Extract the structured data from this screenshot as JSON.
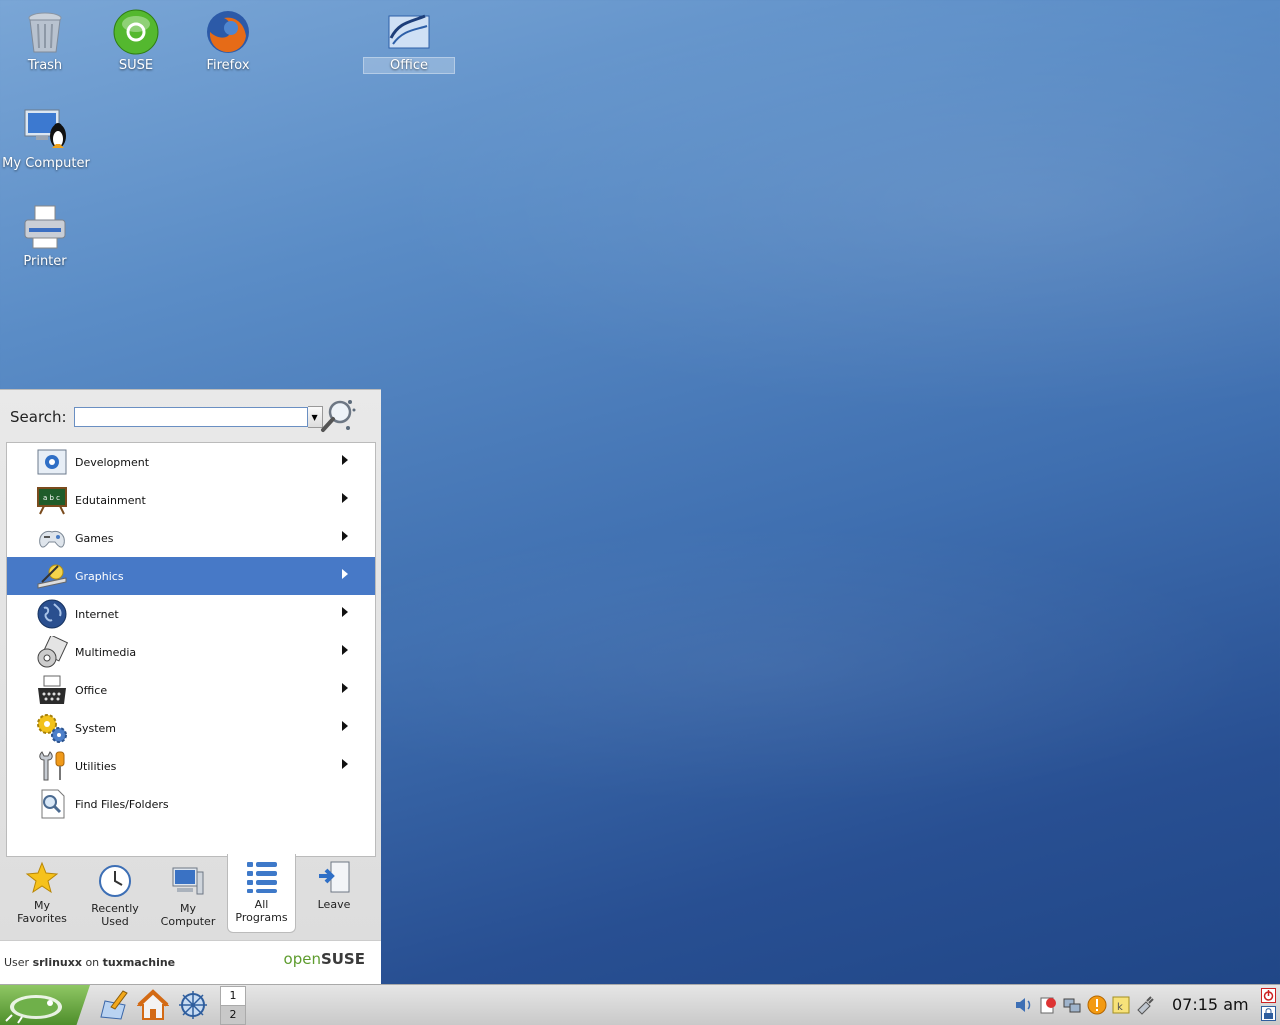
{
  "desktop": {
    "icons": [
      {
        "id": "trash",
        "label": "Trash",
        "icon": "trash-icon"
      },
      {
        "id": "suse",
        "label": "SUSE",
        "icon": "suse-icon"
      },
      {
        "id": "firefox",
        "label": "Firefox",
        "icon": "firefox-icon"
      },
      {
        "id": "office",
        "label": "Office",
        "icon": "office-icon"
      },
      {
        "id": "mycomputer",
        "label": "My Computer",
        "icon": "computer-icon"
      },
      {
        "id": "printer",
        "label": "Printer",
        "icon": "printer-icon"
      }
    ]
  },
  "menu": {
    "search_label": "Search:",
    "search_value": "",
    "items": [
      {
        "label": "Development",
        "icon": "development-icon",
        "submenu": true
      },
      {
        "label": "Edutainment",
        "icon": "edutainment-icon",
        "submenu": true
      },
      {
        "label": "Games",
        "icon": "gamepad-icon",
        "submenu": true
      },
      {
        "label": "Graphics",
        "icon": "graphics-icon",
        "submenu": true,
        "selected": true
      },
      {
        "label": "Internet",
        "icon": "globe-icon",
        "submenu": true
      },
      {
        "label": "Multimedia",
        "icon": "multimedia-icon",
        "submenu": true
      },
      {
        "label": "Office",
        "icon": "typewriter-icon",
        "submenu": true
      },
      {
        "label": "System",
        "icon": "gears-icon",
        "submenu": true
      },
      {
        "label": "Utilities",
        "icon": "tools-icon",
        "submenu": true
      },
      {
        "label": "Find Files/Folders",
        "icon": "find-files-icon",
        "submenu": false
      }
    ],
    "tabs": [
      {
        "line1": "My",
        "line2": "Favorites",
        "ul1": "",
        "ul2": "F",
        "rest2": "avorites",
        "icon": "star-icon"
      },
      {
        "line1": "Recently",
        "line2": "Used",
        "icon": "clock-icon"
      },
      {
        "line1": "My",
        "line2": "Computer",
        "icon": "computer-icon"
      },
      {
        "line1": "All",
        "line2": "Programs",
        "icon": "list-icon",
        "active": true
      },
      {
        "line1": "Leave",
        "line2": "",
        "icon": "leave-icon"
      }
    ],
    "user_prefix": "User",
    "user_name": "srlinuxx",
    "user_on": "on",
    "host": "tuxmachine",
    "brand_open": "open",
    "brand_suse": "SUSE"
  },
  "taskbar": {
    "pager": [
      "1",
      "2"
    ],
    "clock": "07:15 am",
    "colors": {
      "kmenu": "#6fb04a",
      "selection": "#4779c7"
    }
  }
}
